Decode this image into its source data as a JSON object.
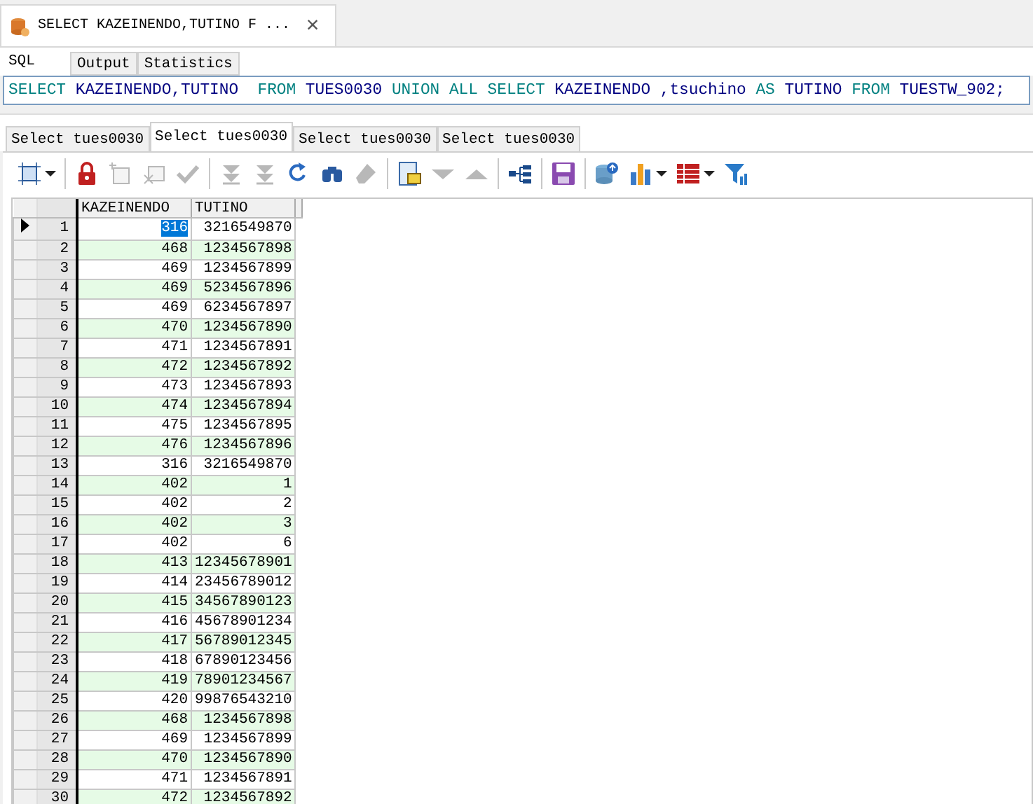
{
  "document_tab": {
    "title": "SELECT KAZEINENDO,TUTINO F ...",
    "close": "×"
  },
  "sub_tabs": [
    {
      "label": "SQL",
      "selected": true
    },
    {
      "label": "Output",
      "selected": false
    },
    {
      "label": "Statistics",
      "selected": false
    }
  ],
  "sql": [
    {
      "kind": "keyword",
      "text": "SELECT "
    },
    {
      "kind": "ident",
      "text": "KAZEINENDO,TUTINO  "
    },
    {
      "kind": "keyword",
      "text": "FROM "
    },
    {
      "kind": "ident",
      "text": "TUES0030 "
    },
    {
      "kind": "keyword",
      "text": "UNION ALL SELECT "
    },
    {
      "kind": "ident",
      "text": "KAZEINENDO ,tsuchino "
    },
    {
      "kind": "keyword",
      "text": "AS "
    },
    {
      "kind": "ident",
      "text": "TUTINO "
    },
    {
      "kind": "keyword",
      "text": "FROM "
    },
    {
      "kind": "ident",
      "text": "TUESTW_902;"
    }
  ],
  "result_tabs": [
    {
      "label": "Select tues0030",
      "selected": false
    },
    {
      "label": "Select tues0030",
      "selected": true
    },
    {
      "label": "Select tues0030",
      "selected": false
    },
    {
      "label": "Select tues0030",
      "selected": false
    }
  ],
  "toolbar": [
    {
      "kind": "frame",
      "disabled": false
    },
    {
      "kind": "caret",
      "disabled": false
    },
    {
      "kind": "sep"
    },
    {
      "kind": "lock",
      "disabled": false
    },
    {
      "kind": "newrow",
      "disabled": true
    },
    {
      "kind": "delrow",
      "disabled": true
    },
    {
      "kind": "check",
      "disabled": true
    },
    {
      "kind": "sep"
    },
    {
      "kind": "last",
      "disabled": true
    },
    {
      "kind": "last",
      "disabled": true
    },
    {
      "kind": "refresh",
      "disabled": false
    },
    {
      "kind": "binoculars",
      "disabled": false
    },
    {
      "kind": "eraser",
      "disabled": true
    },
    {
      "kind": "sep"
    },
    {
      "kind": "form",
      "disabled": false
    },
    {
      "kind": "down",
      "disabled": true
    },
    {
      "kind": "up",
      "disabled": true
    },
    {
      "kind": "sep"
    },
    {
      "kind": "tree",
      "disabled": false
    },
    {
      "kind": "sep"
    },
    {
      "kind": "save",
      "disabled": false
    },
    {
      "kind": "sep"
    },
    {
      "kind": "database",
      "disabled": false
    },
    {
      "kind": "chart",
      "disabled": false
    },
    {
      "kind": "caret",
      "disabled": false
    },
    {
      "kind": "grid",
      "disabled": false
    },
    {
      "kind": "caret",
      "disabled": false
    },
    {
      "kind": "filter",
      "disabled": false
    }
  ],
  "table": {
    "columns": [
      "KAZEINENDO",
      "TUTINO"
    ],
    "rows": [
      {
        "num": "1",
        "cells": [
          "316",
          "3216549870"
        ],
        "selected": true
      },
      {
        "num": "2",
        "cells": [
          "468",
          "1234567898"
        ],
        "selected": false
      },
      {
        "num": "3",
        "cells": [
          "469",
          "1234567899"
        ],
        "selected": false
      },
      {
        "num": "4",
        "cells": [
          "469",
          "5234567896"
        ],
        "selected": false
      },
      {
        "num": "5",
        "cells": [
          "469",
          "6234567897"
        ],
        "selected": false
      },
      {
        "num": "6",
        "cells": [
          "470",
          "1234567890"
        ],
        "selected": false
      },
      {
        "num": "7",
        "cells": [
          "471",
          "1234567891"
        ],
        "selected": false
      },
      {
        "num": "8",
        "cells": [
          "472",
          "1234567892"
        ],
        "selected": false
      },
      {
        "num": "9",
        "cells": [
          "473",
          "1234567893"
        ],
        "selected": false
      },
      {
        "num": "10",
        "cells": [
          "474",
          "1234567894"
        ],
        "selected": false
      },
      {
        "num": "11",
        "cells": [
          "475",
          "1234567895"
        ],
        "selected": false
      },
      {
        "num": "12",
        "cells": [
          "476",
          "1234567896"
        ],
        "selected": false
      },
      {
        "num": "13",
        "cells": [
          "316",
          "3216549870"
        ],
        "selected": false
      },
      {
        "num": "14",
        "cells": [
          "402",
          "1"
        ],
        "selected": false
      },
      {
        "num": "15",
        "cells": [
          "402",
          "2"
        ],
        "selected": false
      },
      {
        "num": "16",
        "cells": [
          "402",
          "3"
        ],
        "selected": false
      },
      {
        "num": "17",
        "cells": [
          "402",
          "6"
        ],
        "selected": false
      },
      {
        "num": "18",
        "cells": [
          "413",
          "12345678901"
        ],
        "selected": false
      },
      {
        "num": "19",
        "cells": [
          "414",
          "23456789012"
        ],
        "selected": false
      },
      {
        "num": "20",
        "cells": [
          "415",
          "34567890123"
        ],
        "selected": false
      },
      {
        "num": "21",
        "cells": [
          "416",
          "45678901234"
        ],
        "selected": false
      },
      {
        "num": "22",
        "cells": [
          "417",
          "56789012345"
        ],
        "selected": false
      },
      {
        "num": "23",
        "cells": [
          "418",
          "67890123456"
        ],
        "selected": false
      },
      {
        "num": "24",
        "cells": [
          "419",
          "78901234567"
        ],
        "selected": false
      },
      {
        "num": "25",
        "cells": [
          "420",
          "99876543210"
        ],
        "selected": false
      },
      {
        "num": "26",
        "cells": [
          "468",
          "1234567898"
        ],
        "selected": false
      },
      {
        "num": "27",
        "cells": [
          "469",
          "1234567899"
        ],
        "selected": false
      },
      {
        "num": "28",
        "cells": [
          "470",
          "1234567890"
        ],
        "selected": false
      },
      {
        "num": "29",
        "cells": [
          "471",
          "1234567891"
        ],
        "selected": false
      },
      {
        "num": "30",
        "cells": [
          "472",
          "1234567892"
        ],
        "selected": false
      }
    ]
  }
}
